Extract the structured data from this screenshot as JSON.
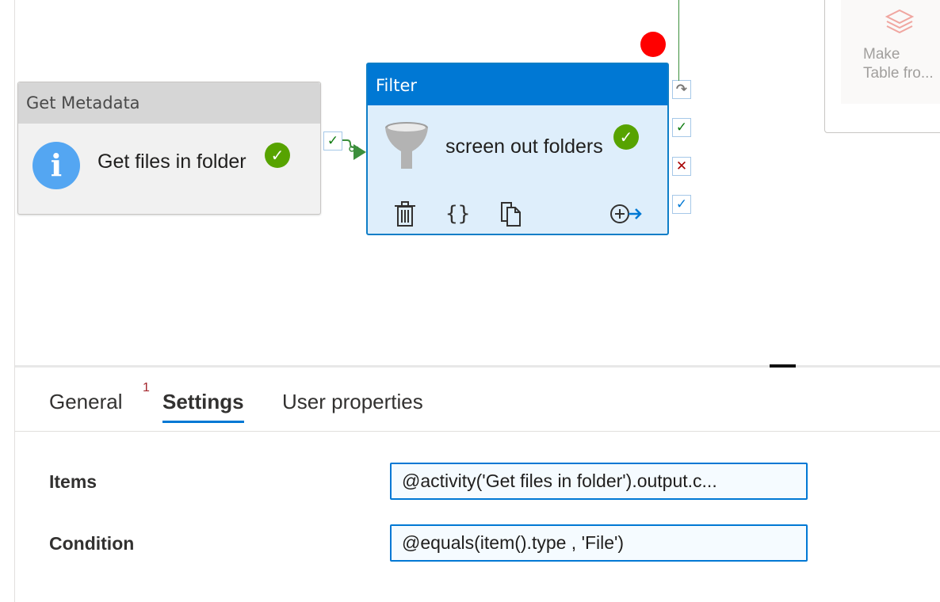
{
  "canvas": {
    "get_metadata": {
      "type_label": "Get Metadata",
      "name": "Get files in folder",
      "status_icon": "success-check-icon",
      "icon": "info-icon"
    },
    "filter": {
      "type_label": "Filter",
      "name": "screen out folders",
      "status_icon": "success-check-icon",
      "icon": "funnel-icon",
      "actions": [
        "delete-icon",
        "code-icon",
        "copy-icon",
        "add-output-icon"
      ]
    },
    "output_ports": [
      "skip-arrow-icon",
      "success-check-icon",
      "failure-x-icon",
      "completion-check-icon"
    ],
    "side_activity": {
      "line1": "Make",
      "line2": "Table fro..."
    },
    "colors": {
      "accent": "#0078d4",
      "success": "#57a300",
      "failure": "#a80000",
      "error_dot": "#ff0000"
    }
  },
  "panel": {
    "tabs": [
      {
        "label": "General",
        "badge": "1",
        "active": false
      },
      {
        "label": "Settings",
        "active": true
      },
      {
        "label": "User properties",
        "active": false
      }
    ],
    "fields": [
      {
        "label": "Items",
        "value": "@activity('Get files in folder').output.c..."
      },
      {
        "label": "Condition",
        "value": "@equals(item().type , 'File')"
      }
    ]
  }
}
